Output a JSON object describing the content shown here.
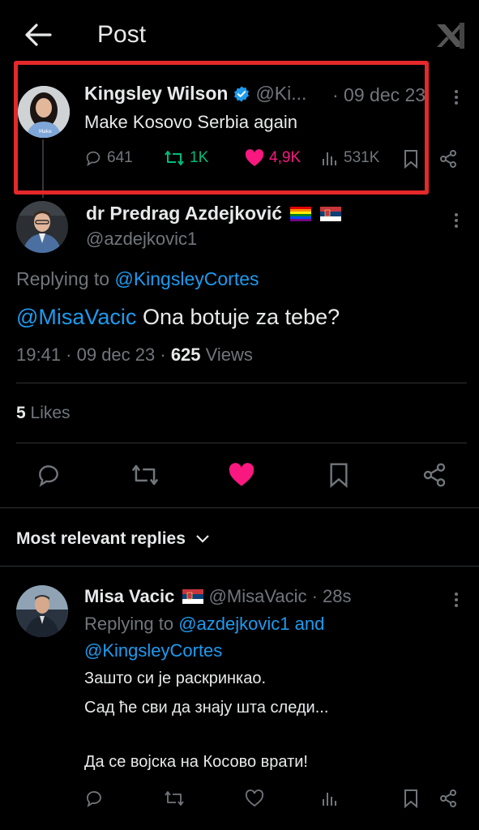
{
  "header": {
    "title": "Post"
  },
  "quoted": {
    "name": "Kingsley Wilson",
    "handle": "@Ki...",
    "date": "· 09 dec 23",
    "text": "Make Kosovo Serbia again",
    "replies": "641",
    "reposts": "1K",
    "likes": "4,9K",
    "views": "531K"
  },
  "main": {
    "name": "dr Predrag Azdejković",
    "handle": "@azdejkovic1",
    "replying_prefix": "Replying to",
    "replying_to": "@KingsleyCortes",
    "mention": "@MisaVacic",
    "text": " Ona botuje za tebe?",
    "time": "19:41 · 09 dec 23 ·",
    "views_count": "625",
    "views_label": " Views",
    "likes_count": "5",
    "likes_label": " Likes"
  },
  "replies_section": {
    "label": "Most relevant replies"
  },
  "reply": {
    "name": "Misa Vacic",
    "handle": "@MisaVacic · 28s",
    "replying_prefix": "Replying to",
    "replying_to_1": "@azdejkovic1 and",
    "replying_to_2": "@KingsleyCortes",
    "line1": "Зашто си је раскринкао.",
    "line2": "Сад ће сви да знају шта следи...",
    "line3": "Да се војска на Косово врати!"
  },
  "colors": {
    "accent": "#1d9bf0",
    "like": "#f91880",
    "repost": "#00ba7c",
    "highlight": "#e5282a"
  }
}
